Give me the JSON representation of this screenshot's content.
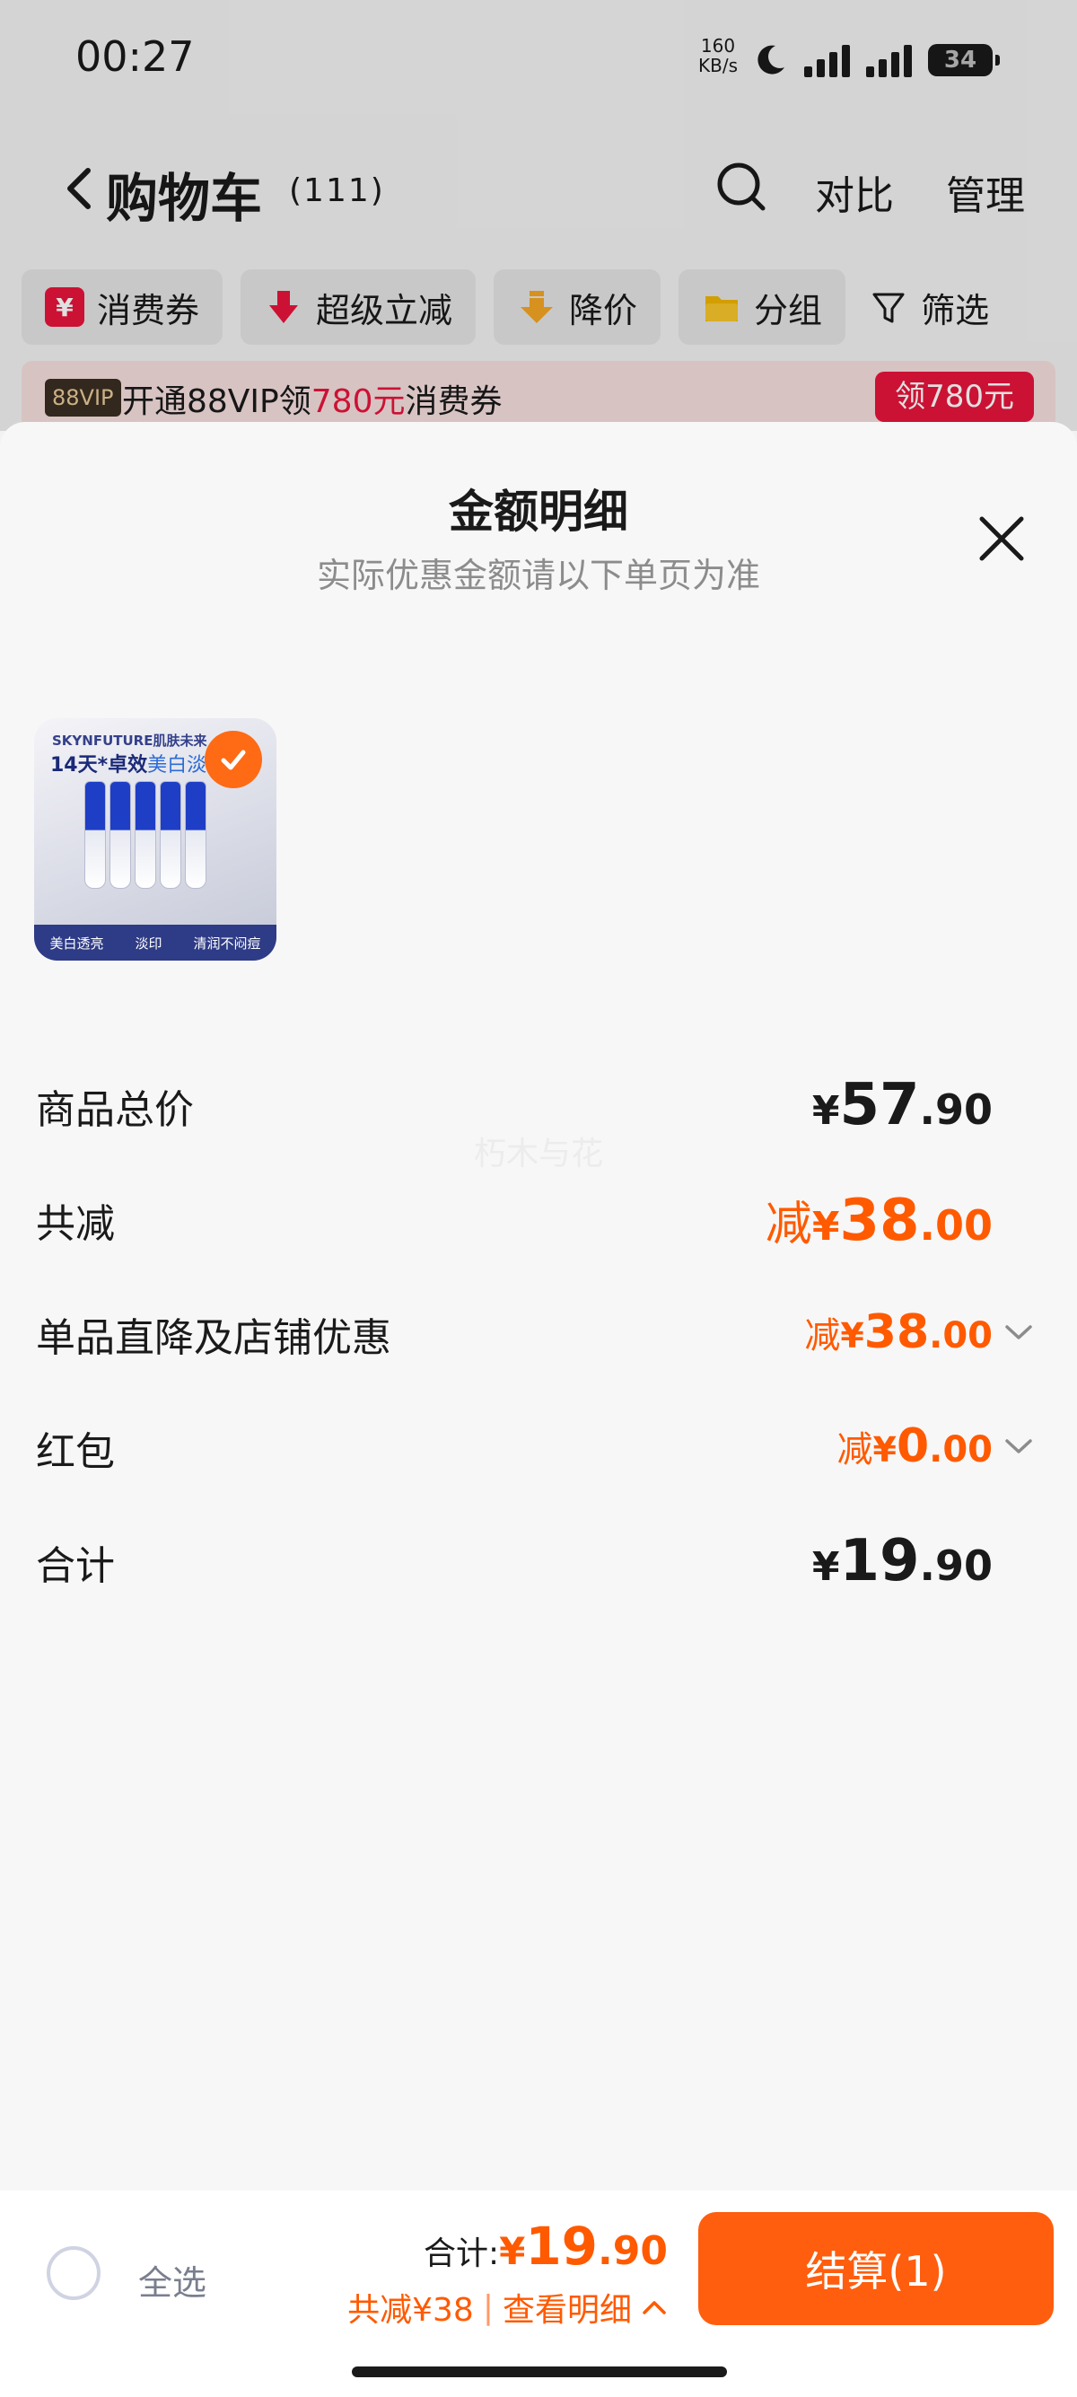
{
  "status_bar": {
    "time": "00:27",
    "net_speed_value": "160",
    "net_speed_unit": "KB/s",
    "battery": "34"
  },
  "nav": {
    "title": "购物车",
    "count": "(111)",
    "compare": "对比",
    "manage": "管理"
  },
  "filters": [
    {
      "label": "消费券",
      "icon": "yen-coupon-icon"
    },
    {
      "label": "超级立减",
      "icon": "red-down-arrow-icon"
    },
    {
      "label": "降价",
      "icon": "orange-down-arrow-icon"
    },
    {
      "label": "分组",
      "icon": "folder-icon"
    },
    {
      "label": "筛选",
      "icon": "funnel-icon"
    }
  ],
  "vip_banner": {
    "badge": "88VIP",
    "text_before": "开通88VIP领",
    "highlight": "780元",
    "text_after": "消费券",
    "button": "领780元"
  },
  "sheet": {
    "title": "金额明细",
    "subtitle": "实际优惠金额请以下单页为准",
    "watermark": "朽木与花",
    "product_image_text": {
      "brand": "SKYNFUTURE肌肤未来",
      "headline_bold": "14天*卓效",
      "headline_light": "美白淡印",
      "footer": [
        "美白透亮",
        "淡印",
        "清润不闷痘"
      ]
    }
  },
  "rows": [
    {
      "label": "商品总价",
      "prefix": "",
      "yen": "¥",
      "int": "57",
      "dec": ".90"
    },
    {
      "label": "共减",
      "prefix": "减",
      "yen": "¥",
      "int": "38",
      "dec": ".00"
    },
    {
      "label": "单品直降及店铺优惠",
      "prefix": "减",
      "yen": "¥",
      "int": "38",
      "dec": ".00"
    },
    {
      "label": "红包",
      "prefix": "减",
      "yen": "¥",
      "int": "0",
      "dec": ".00"
    },
    {
      "label": "合计",
      "prefix": "",
      "yen": "¥",
      "int": "19",
      "dec": ".90"
    }
  ],
  "bottom_bar": {
    "select_all": "全选",
    "total_label": "合计:",
    "total_yen": "¥",
    "total_int": "19",
    "total_dec": ".90",
    "savings": "共减¥38",
    "separator": "|",
    "view_details": "查看明细",
    "checkout": "结算(1)"
  },
  "colors": {
    "accent_orange": "#ff5e0e",
    "discount_red": "#e8153c"
  }
}
